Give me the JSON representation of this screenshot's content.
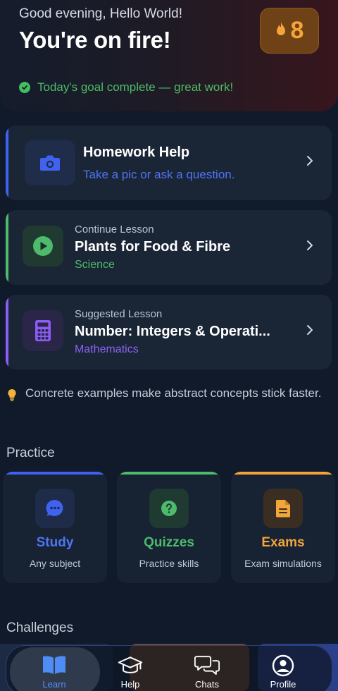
{
  "hero": {
    "greeting": "Good evening, Hello World!",
    "title": "You're on fire!",
    "goal_text": "Today's goal complete — great work!",
    "streak_count": "8"
  },
  "cards": [
    {
      "kicker": "",
      "title": "Homework Help",
      "subtitle": "Take a pic or ask a question.",
      "icon": "camera-icon",
      "accent": "#3f62f0"
    },
    {
      "kicker": "Continue Lesson",
      "title": "Plants for Food & Fibre",
      "subtitle": "Science",
      "icon": "play-icon",
      "accent": "#4dbb6b"
    },
    {
      "kicker": "Suggested Lesson",
      "title": "Number: Integers & Operati...",
      "subtitle": "Mathematics",
      "icon": "calculator-icon",
      "accent": "#8b5cf6"
    }
  ],
  "tip": "Concrete examples make abstract concepts stick faster.",
  "practice": {
    "heading": "Practice",
    "tiles": [
      {
        "name": "Study",
        "sub": "Any subject",
        "icon": "chat-bubble-icon",
        "color": "#3f62f0"
      },
      {
        "name": "Quizzes",
        "sub": "Practice skills",
        "icon": "question-icon",
        "color": "#4dbb6b"
      },
      {
        "name": "Exams",
        "sub": "Exam simulations",
        "icon": "document-icon",
        "color": "#f2a53a"
      }
    ]
  },
  "challenges": {
    "heading": "Challenges"
  },
  "nav": [
    {
      "label": "Learn",
      "icon": "book-icon",
      "active": true
    },
    {
      "label": "Help",
      "icon": "graduation-cap-icon",
      "active": false
    },
    {
      "label": "Chats",
      "icon": "chats-icon",
      "active": false
    },
    {
      "label": "Profile",
      "icon": "profile-icon",
      "active": false
    }
  ],
  "colors": {
    "accent_blue": "#3f62f0",
    "accent_green": "#4dbb6b",
    "accent_purple": "#8b5cf6",
    "accent_orange": "#f2a53a",
    "background": "#111a2b"
  }
}
